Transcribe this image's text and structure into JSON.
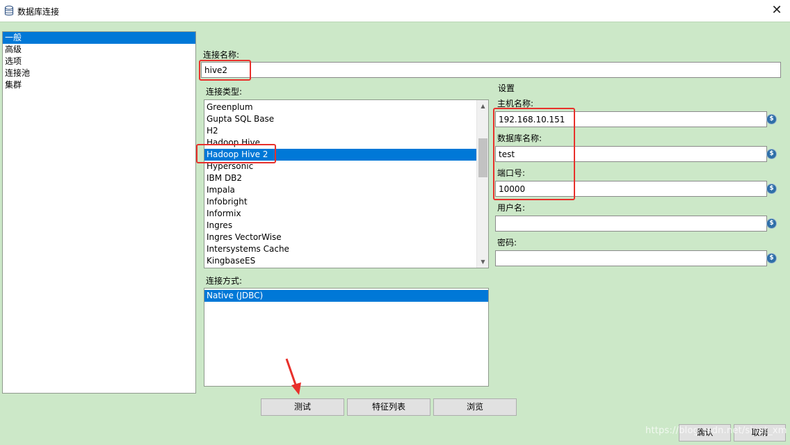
{
  "window": {
    "title": "数据库连接",
    "close_glyph": "✕"
  },
  "nav": {
    "items": [
      {
        "label": "一般",
        "selected": true
      },
      {
        "label": "高级"
      },
      {
        "label": "选项"
      },
      {
        "label": "连接池"
      },
      {
        "label": "集群"
      }
    ]
  },
  "form": {
    "connection_name_label": "连接名称:",
    "connection_name_value": "hive2",
    "connection_type_label": "连接类型:",
    "connection_types": [
      "Greenplum",
      "Gupta SQL Base",
      "H2",
      "Hadoop Hive",
      "Hadoop Hive 2",
      "Hypersonic",
      "IBM DB2",
      "Impala",
      "Infobright",
      "Informix",
      "Ingres",
      "Ingres VectorWise",
      "Intersystems Cache",
      "KingbaseES"
    ],
    "connection_type_selected": "Hadoop Hive 2",
    "access_label": "连接方式:",
    "access_methods": [
      "Native (JDBC)"
    ],
    "access_selected": "Native (JDBC)"
  },
  "settings": {
    "title": "设置",
    "host_label": "主机名称:",
    "host_value": "192.168.10.151",
    "db_label": "数据库名称:",
    "db_value": "test",
    "port_label": "端口号:",
    "port_value": "10000",
    "user_label": "用户名:",
    "user_value": "",
    "password_label": "密码:",
    "password_value": "",
    "variable_icon_glyph": "$"
  },
  "buttons": {
    "test": "测试",
    "features": "特征列表",
    "explore": "浏览",
    "ok": "确认",
    "cancel": "取消"
  },
  "scroll": {
    "up": "▲",
    "down": "▼"
  },
  "watermark": "https://blog.csdn.net/sinat_xm",
  "colors": {
    "background": "#cce8c8",
    "selection": "#0078d7",
    "highlight_box": "#e8302b",
    "annotation_arrow": "#e8302b"
  }
}
